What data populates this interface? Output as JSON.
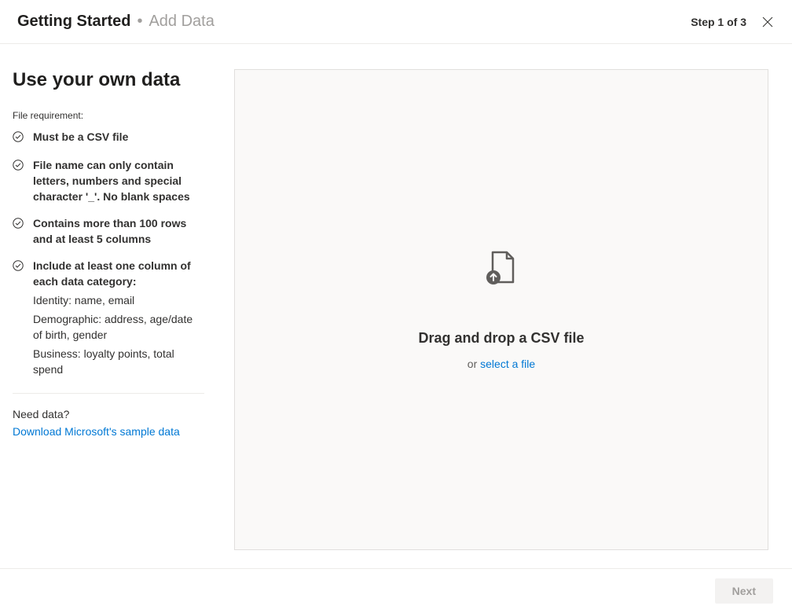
{
  "header": {
    "title": "Getting Started",
    "separator": "•",
    "subtitle": "Add Data",
    "step": "Step 1 of 3"
  },
  "sidebar": {
    "heading": "Use your own data",
    "file_requirement_label": "File requirement:",
    "requirements": [
      {
        "text": "Must be a CSV file",
        "subs": []
      },
      {
        "text": "File name can only contain letters, numbers and special character '_'. No blank spaces",
        "subs": []
      },
      {
        "text": "Contains more than 100 rows and at least 5 columns",
        "subs": []
      },
      {
        "text": "Include at least one column of each data category:",
        "subs": [
          "Identity: name, email",
          "Demographic: address, age/date of birth, gender",
          "Business: loyalty points, total spend"
        ]
      }
    ],
    "need_data_label": "Need data?",
    "download_link_text": "Download Microsoft's sample data"
  },
  "dropzone": {
    "title": "Drag and drop a CSV file",
    "or_text": "or ",
    "select_link": "select a file"
  },
  "footer": {
    "next_label": "Next"
  }
}
